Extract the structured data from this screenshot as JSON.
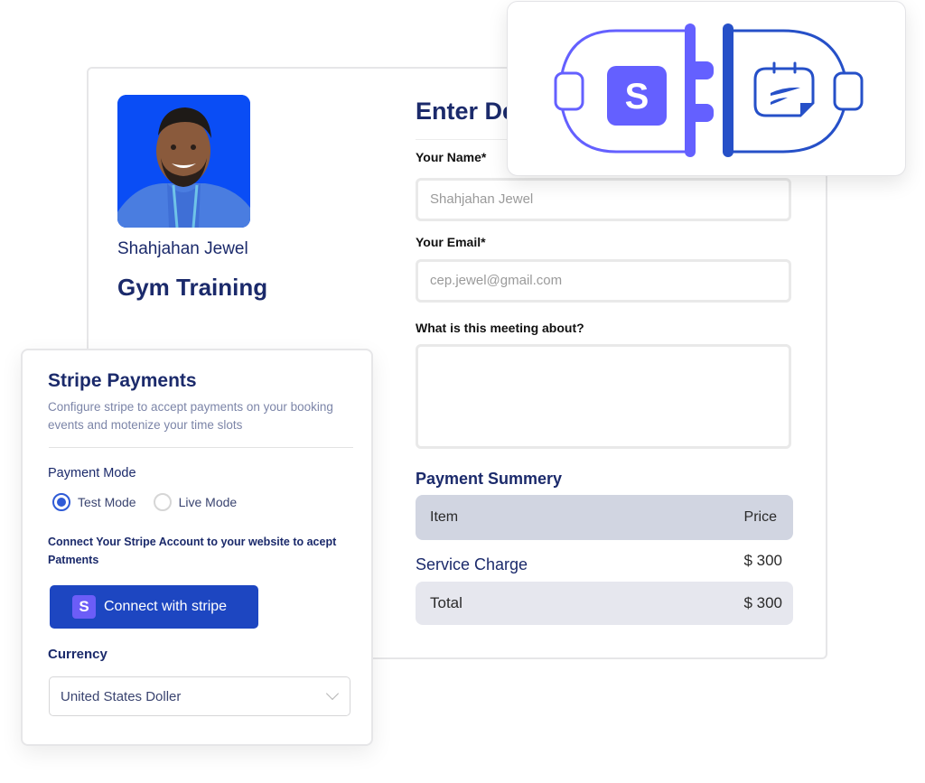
{
  "booking": {
    "host_name": "Shahjahan Jewel",
    "event_title": "Gym Training",
    "form_title": "Enter Details",
    "fields": {
      "name": {
        "label": "Your Name*",
        "value": "Shahjahan Jewel"
      },
      "email": {
        "label": "Your Email*",
        "value": "cep.jewel@gmail.com"
      },
      "about": {
        "label": "What is this meeting about?",
        "value": ""
      }
    },
    "summary": {
      "title": "Payment Summery",
      "header": {
        "item": "Item",
        "price": "Price"
      },
      "rows": [
        {
          "name": "Service Charge",
          "price": "$ 300"
        }
      ],
      "total": {
        "label": "Total",
        "price": "$ 300"
      }
    }
  },
  "integration": {
    "left_icon": "stripe-s-icon",
    "left_glyph": "S",
    "right_icon": "calendar-note-icon",
    "colors": {
      "stripe": "#6460ff",
      "app": "#2650c8"
    }
  },
  "stripe": {
    "title": "Stripe Payments",
    "description": "Configure stripe to accept payments on your booking events and motenize your time slots",
    "payment_mode_label": "Payment Mode",
    "modes": [
      {
        "label": "Test Mode",
        "checked": true
      },
      {
        "label": "Live Mode",
        "checked": false
      }
    ],
    "connect_text": "Connect Your Stripe Account to your website to acept Patments",
    "connect_button": {
      "glyph": "S",
      "label": "Connect with stripe"
    },
    "currency_label": "Currency",
    "currency_value": "United States Doller"
  }
}
